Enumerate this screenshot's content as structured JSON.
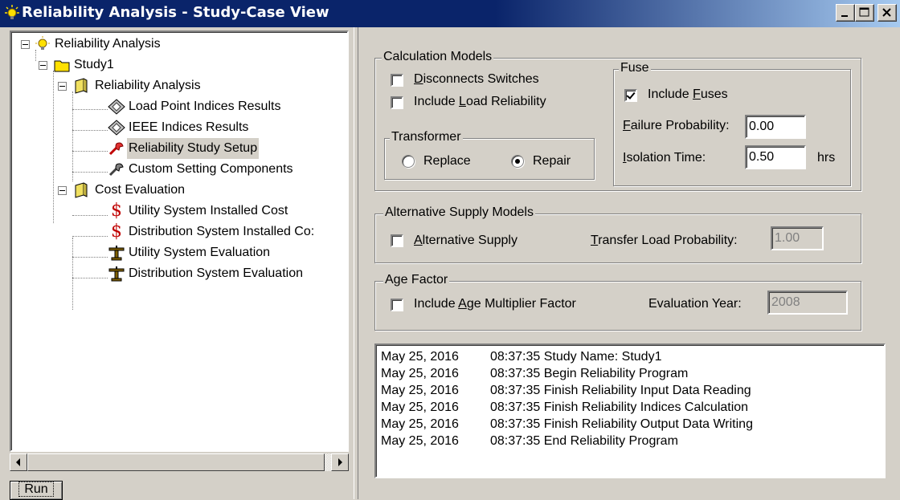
{
  "window": {
    "title": "Reliability Analysis - Study-Case View",
    "buttons": {
      "minimize": "minimize",
      "maximize": "maximize",
      "close": "close"
    }
  },
  "tree": {
    "root": {
      "label": "Reliability Analysis",
      "icon": "lightbulb-icon"
    },
    "study": {
      "label": "Study1",
      "icon": "folder-icon"
    },
    "reliability_group": {
      "label": "Reliability Analysis",
      "icon": "open-book-icon"
    },
    "reliability_items": [
      {
        "label": "Load Point Indices Results",
        "icon": "diamond-report-icon"
      },
      {
        "label": "IEEE Indices Results",
        "icon": "diamond-report-icon"
      },
      {
        "label": "Reliability Study Setup",
        "icon": "red-tool-icon",
        "selected": true
      },
      {
        "label": "Custom Setting Components",
        "icon": "gray-tool-icon"
      }
    ],
    "cost_group": {
      "label": "Cost Evaluation",
      "icon": "open-book-icon"
    },
    "cost_items": [
      {
        "label": "Utility System Installed Cost",
        "icon": "dollar-icon"
      },
      {
        "label": "Distribution System Installed Co:",
        "icon": "dollar-icon"
      },
      {
        "label": "Utility System Evaluation",
        "icon": "scale-icon"
      },
      {
        "label": "Distribution System Evaluation",
        "icon": "scale-icon"
      }
    ]
  },
  "run_label": "Run",
  "calc_models": {
    "title": "Calculation Models",
    "disconnect_switches": {
      "pre": "",
      "key": "D",
      "post": "isconnects Switches",
      "checked": false
    },
    "load_reliability": {
      "pre": "Include ",
      "key": "L",
      "post": "oad Reliability",
      "checked": false
    },
    "transformer": {
      "title": "Transformer",
      "replace": {
        "label": "Replace",
        "selected": false
      },
      "repair": {
        "label": "Repair",
        "selected": true
      }
    },
    "fuse": {
      "title": "Fuse",
      "include_fuses": {
        "pre": "Include ",
        "key": "F",
        "post": "uses",
        "checked": true
      },
      "failure_probability": {
        "key": "F",
        "post": "ailure Probability:",
        "value": "0.00"
      },
      "isolation_time": {
        "key": "I",
        "post": "solation Time:",
        "value": "0.50",
        "unit": "hrs"
      }
    }
  },
  "alt_supply": {
    "title": "Alternative Supply Models",
    "alternative_supply": {
      "key": "A",
      "post": "lternative Supply",
      "checked": false
    },
    "transfer_load": {
      "key": "T",
      "post": "ransfer Load Probability:",
      "value": "1.00"
    }
  },
  "age_factor": {
    "title": "Age Factor",
    "include_age": {
      "pre": "Include ",
      "key": "A",
      "post": "ge Multiplier Factor",
      "checked": false
    },
    "evaluation_year": {
      "label": "Evaluation Year:",
      "value": "2008"
    }
  },
  "log": [
    {
      "date": "May 25, 2016",
      "msg": "08:37:35 Study Name: Study1"
    },
    {
      "date": "May 25, 2016",
      "msg": "08:37:35 Begin Reliability Program"
    },
    {
      "date": "May 25, 2016",
      "msg": "08:37:35 Finish Reliability Input Data Reading"
    },
    {
      "date": "May 25, 2016",
      "msg": "08:37:35 Finish Reliability Indices Calculation"
    },
    {
      "date": "May 25, 2016",
      "msg": "08:37:35 Finish Reliability Output Data Writing"
    },
    {
      "date": "May 25, 2016",
      "msg": "08:37:35 End Reliability Program"
    }
  ]
}
